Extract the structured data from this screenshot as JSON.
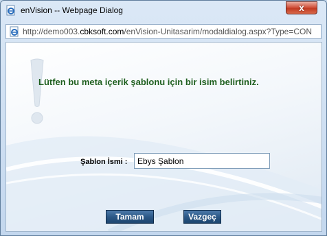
{
  "window": {
    "title": "enVision -- Webpage Dialog",
    "close_label": "x"
  },
  "address": {
    "prefix": "http://demo003.",
    "host": "cbksoft.com",
    "suffix": "/enVision-Unitasarim/modaldialog.aspx?Type=CON"
  },
  "dialog": {
    "message": "Lütfen bu meta içerik şablonu için bir isim belirtiniz.",
    "field_label": "Şablon İsmi :",
    "field_value": "Ebys Şablon",
    "ok_label": "Tamam",
    "cancel_label": "Vazgeç"
  },
  "colors": {
    "message_text": "#1f5f1f",
    "button_bg": "#2c5887",
    "close_button": "#c23b22"
  },
  "icons": {
    "title": "ie-page-icon",
    "address": "ie-page-icon",
    "decoration": "exclamation-mark-icon"
  }
}
